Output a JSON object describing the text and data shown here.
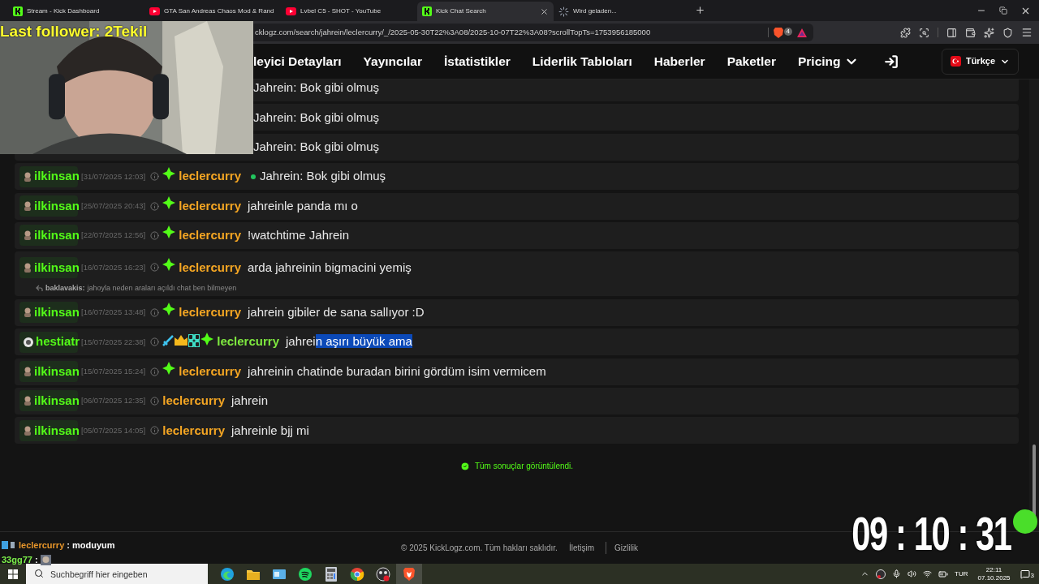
{
  "browser": {
    "tabs": [
      {
        "title": "Stream - Kick Dashboard",
        "kind": "kick",
        "selected": false
      },
      {
        "title": "GTA San Andreas Chaos Mod & Rand",
        "kind": "youtube",
        "selected": false
      },
      {
        "title": "Lvbel C5 - SHOT - YouTube",
        "kind": "youtube",
        "selected": false
      },
      {
        "title": "Kick Chat Search",
        "kind": "kick",
        "selected": true
      },
      {
        "title": "Wird geladen...",
        "kind": "loading",
        "selected": false
      }
    ],
    "address": "cklogz.com/search/jahrein/leclercurry/_/2025-05-30T22%3A08/2025-10-07T22%3A08?scrollTopTs=1753956185000",
    "shield_count": "4"
  },
  "site_nav": {
    "items": [
      {
        "label": "leyici Detayları",
        "dropdown": false
      },
      {
        "label": "Yayıncılar",
        "dropdown": false
      },
      {
        "label": "İstatistikler",
        "dropdown": false
      },
      {
        "label": "Liderlik Tabloları",
        "dropdown": false
      },
      {
        "label": "Haberler",
        "dropdown": false
      },
      {
        "label": "Paketler",
        "dropdown": false
      },
      {
        "label": "Pricing",
        "dropdown": true
      }
    ],
    "language": "Türkçe"
  },
  "messages": [
    {
      "kind": "partial",
      "message": "Jahrein: Bok gibi olmuş"
    },
    {
      "kind": "partial",
      "message": "Jahrein: Bok gibi olmuş"
    },
    {
      "kind": "partial",
      "message": "Jahrein: Bok gibi olmuş"
    },
    {
      "kind": "full",
      "user": "ilkinsan",
      "avatar": {
        "kind": "figure"
      },
      "time": "[31/07/2025 12:03]",
      "badges": [
        {
          "kind": "sub"
        }
      ],
      "author": "leclercurry",
      "color": "#f5a623",
      "status_dot": true,
      "message": "Jahrein: Bok gibi olmuş"
    },
    {
      "kind": "full",
      "user": "ilkinsan",
      "avatar": {
        "kind": "figure"
      },
      "time": "[25/07/2025 20:43]",
      "badges": [
        {
          "kind": "sub"
        }
      ],
      "author": "leclercurry",
      "color": "#f5a623",
      "status_dot": false,
      "message": "jahreinle panda mı o"
    },
    {
      "kind": "full",
      "user": "ilkinsan",
      "avatar": {
        "kind": "figure"
      },
      "time": "[22/07/2025 12:56]",
      "badges": [
        {
          "kind": "sub"
        }
      ],
      "author": "leclercurry",
      "color": "#f5a623",
      "status_dot": false,
      "message": "!watchtime Jahrein"
    },
    {
      "kind": "full",
      "user": "ilkinsan",
      "avatar": {
        "kind": "figure"
      },
      "time": "[16/07/2025 16:23]",
      "badges": [
        {
          "kind": "sub"
        }
      ],
      "author": "leclercurry",
      "color": "#f5a623",
      "status_dot": false,
      "message": "arda jahreinin bigmacini yemiş",
      "reply": {
        "user": "baklavakis:",
        "text": "jahoyla neden araları açıldı chat ben bilmeyen"
      }
    },
    {
      "kind": "full",
      "user": "ilkinsan",
      "avatar": {
        "kind": "figure"
      },
      "time": "[16/07/2025 13:48]",
      "badges": [
        {
          "kind": "sub"
        }
      ],
      "author": "leclercurry",
      "color": "#f5a623",
      "status_dot": false,
      "message": "jahrein gibiler de sana sallıyor :D"
    },
    {
      "kind": "full",
      "user": "hestiatr",
      "avatar": {
        "kind": "disc"
      },
      "time": "[15/07/2025 22:38]",
      "badges": [
        {
          "kind": "sword"
        },
        {
          "kind": "crown"
        },
        {
          "kind": "og"
        },
        {
          "kind": "sub"
        }
      ],
      "author": "leclercurry",
      "color": "#7ee83f",
      "status_dot": false,
      "message": "jahrei",
      "selection": "n aşırı büyük ama"
    },
    {
      "kind": "full",
      "user": "ilkinsan",
      "avatar": {
        "kind": "figure"
      },
      "time": "[15/07/2025 15:24]",
      "badges": [
        {
          "kind": "sub"
        }
      ],
      "author": "leclercurry",
      "color": "#f5a623",
      "status_dot": false,
      "message": "jahreinin chatinde buradan birini gördüm isim vermicem"
    },
    {
      "kind": "full",
      "user": "ilkinsan",
      "avatar": {
        "kind": "figure"
      },
      "time": "[06/07/2025 12:35]",
      "author": "leclercurry",
      "color": "#f5a623",
      "status_dot": false,
      "message": "jahrein"
    },
    {
      "kind": "full",
      "user": "ilkinsan",
      "avatar": {
        "kind": "figure"
      },
      "time": "[05/07/2025 14:05]",
      "author": "leclercurry",
      "color": "#f5a623",
      "status_dot": false,
      "message": "jahreinle bjj mi"
    }
  ],
  "end_notice": "Tüm sonuçlar görüntülendi.",
  "footer": {
    "copyright": "© 2025 KickLogz.com. Tüm hakları saklıdır.",
    "links": [
      "İletişim",
      "Gizlilik"
    ]
  },
  "overlay": {
    "follower": "Last follower: 2Tekil",
    "chat": [
      {
        "kind": "badged",
        "user": "leclercurry",
        "color": "#e8962a",
        "text": ": moduyum"
      },
      {
        "kind": "emote",
        "user": "33gg77",
        "color": "#7cf04a",
        "text": ":"
      }
    ],
    "clock": "09 : 10 : 31"
  },
  "taskbar": {
    "search_placeholder": "Suchbegriff hier eingeben",
    "apps": [
      {
        "kind": "edge",
        "selected": false
      },
      {
        "kind": "folder",
        "selected": false
      },
      {
        "kind": "app",
        "selected": false
      },
      {
        "kind": "spotify",
        "selected": false
      },
      {
        "kind": "calculator",
        "selected": false
      },
      {
        "kind": "chrome",
        "selected": false
      },
      {
        "kind": "obs",
        "selected": false
      },
      {
        "kind": "brave",
        "selected": true
      }
    ],
    "language": "TUR",
    "time": "22:11",
    "date": "07.10.2025",
    "notifications": "3"
  }
}
